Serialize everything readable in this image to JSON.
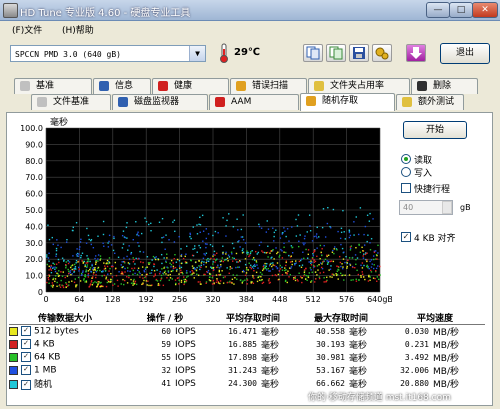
{
  "window": {
    "title": "HD Tune 专业版 4.60 - 硬盘专业工具",
    "min": "—",
    "max": "□",
    "close": "✕"
  },
  "menu": {
    "file": "(F)文件",
    "help": "(H)帮助"
  },
  "toolbar": {
    "drive": "SPCCN  PMD 3.0 (640 gB)",
    "temperature": "29℃",
    "exit": "退出"
  },
  "tabs_top": [
    {
      "label": "基准",
      "icon": "benchmark-icon"
    },
    {
      "label": "信息",
      "icon": "info-icon"
    },
    {
      "label": "健康",
      "icon": "health-icon"
    },
    {
      "label": "错误扫描",
      "icon": "error-scan-icon"
    },
    {
      "label": "文件夹占用率",
      "icon": "folder-icon"
    },
    {
      "label": "删除",
      "icon": "delete-icon"
    }
  ],
  "tabs_bottom": [
    {
      "label": "文件基准",
      "icon": "file-benchmark-icon"
    },
    {
      "label": "磁盘监视器",
      "icon": "disk-monitor-icon"
    },
    {
      "label": "AAM",
      "icon": "speaker-icon"
    },
    {
      "label": "随机存取",
      "icon": "random-access-icon",
      "active": true
    },
    {
      "label": "额外测试",
      "icon": "extra-tests-icon"
    }
  ],
  "controls": {
    "start": "开始",
    "read": "读取",
    "write": "写入",
    "short_stroke": "快捷行程",
    "stroke_value": "40",
    "stroke_unit": "gB",
    "align_4kb": "4 KB 对齐"
  },
  "chart_data": {
    "type": "scatter",
    "ylabel": "毫秒",
    "ylim": [
      0,
      100
    ],
    "y_ticks": [
      "100.0",
      "90.0",
      "80.0",
      "70.0",
      "60.0",
      "50.0",
      "40.0",
      "30.0",
      "20.0",
      "10.0",
      "0"
    ],
    "xlim": [
      0,
      640
    ],
    "x_ticks": [
      "0",
      "64",
      "128",
      "192",
      "256",
      "320",
      "384",
      "448",
      "512",
      "576",
      "640gB"
    ],
    "grid": true,
    "series": [
      {
        "name": "512 bytes",
        "color": "#e8e820",
        "approx_min_ms": 3,
        "approx_max_ms": 24,
        "slope_ms": 10
      },
      {
        "name": "4 KB",
        "color": "#e02020",
        "approx_min_ms": 3,
        "approx_max_ms": 24,
        "slope_ms": 10
      },
      {
        "name": "64 KB",
        "color": "#28c028",
        "approx_min_ms": 4,
        "approx_max_ms": 26,
        "slope_ms": 10
      },
      {
        "name": "1 MB",
        "color": "#2050e0",
        "approx_min_ms": 10,
        "approx_max_ms": 40,
        "slope_ms": 12
      },
      {
        "name": "随机",
        "color": "#20c8d8",
        "approx_min_ms": 12,
        "approx_max_ms": 48,
        "slope_ms": 12
      }
    ]
  },
  "table": {
    "headers": [
      "传输数据大小",
      "操作 / 秒",
      "平均存取时间",
      "最大存取时间",
      "平均速度"
    ],
    "rows": [
      {
        "color": "#e8e820",
        "check": "✓",
        "size": "512 bytes",
        "ops": "60",
        "ops_unit": "IOPS",
        "avg": "16.471",
        "avg_unit": "毫秒",
        "max": "40.558",
        "max_unit": "毫秒",
        "speed": "0.030",
        "speed_unit": "MB/秒"
      },
      {
        "color": "#d02020",
        "check": "✓",
        "size": "4 KB",
        "ops": "59",
        "ops_unit": "IOPS",
        "avg": "16.885",
        "avg_unit": "毫秒",
        "max": "30.193",
        "max_unit": "毫秒",
        "speed": "0.231",
        "speed_unit": "MB/秒"
      },
      {
        "color": "#28c028",
        "check": "✓",
        "size": "64 KB",
        "ops": "55",
        "ops_unit": "IOPS",
        "avg": "17.898",
        "avg_unit": "毫秒",
        "max": "30.981",
        "max_unit": "毫秒",
        "speed": "3.492",
        "speed_unit": "MB/秒"
      },
      {
        "color": "#2050e0",
        "check": "✓",
        "size": "1 MB",
        "ops": "32",
        "ops_unit": "IOPS",
        "avg": "31.243",
        "avg_unit": "毫秒",
        "max": "53.167",
        "max_unit": "毫秒",
        "speed": "32.006",
        "speed_unit": "MB/秒"
      },
      {
        "color": "#20c8d8",
        "check": "✓",
        "size": "随机",
        "ops": "41",
        "ops_unit": "IOPS",
        "avg": "24.300",
        "avg_unit": "毫秒",
        "max": "66.662",
        "max_unit": "毫秒",
        "speed": "20.880",
        "speed_unit": "MB/秒"
      }
    ]
  },
  "watermark": "你的·移动存储频道 mst.it168.com"
}
